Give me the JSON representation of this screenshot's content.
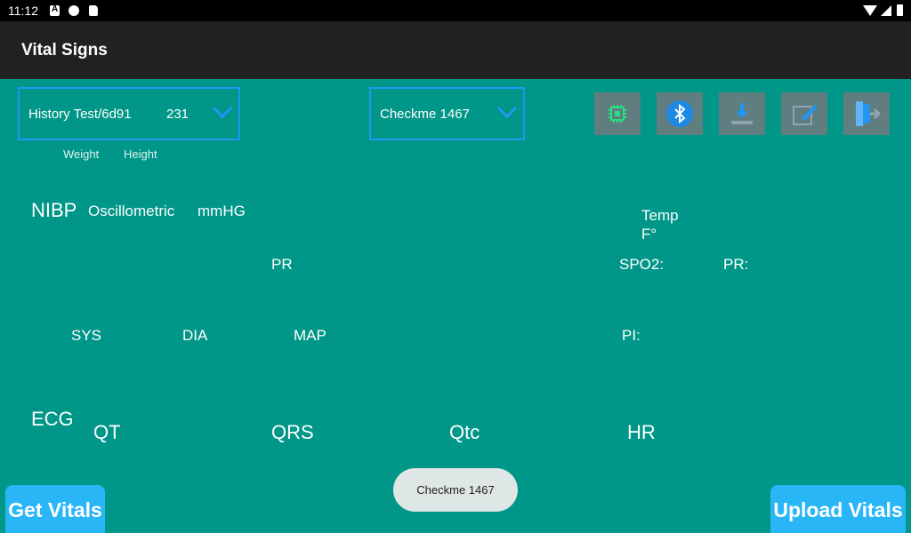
{
  "status_bar": {
    "time": "11:12"
  },
  "app_bar": {
    "title": "Vital Signs"
  },
  "patient_dropdown": {
    "name": "History Test/6d91",
    "id": "231"
  },
  "device_dropdown": {
    "value": "Checkme 1467"
  },
  "weight_label": "Weight",
  "height_label": "Height",
  "toolbar_icons": [
    "chip-icon",
    "bluetooth-icon",
    "download-icon",
    "edit-icon",
    "logout-icon"
  ],
  "nibp": {
    "title": "NIBP",
    "method": "Oscillometric",
    "unit": "mmHG",
    "pr": "PR",
    "sys": "SYS",
    "dia": "DIA",
    "map": "MAP"
  },
  "temp": {
    "label": "Temp",
    "unit": "F°"
  },
  "spo2": {
    "spo2": "SPO2:",
    "pr": "PR:",
    "pi": "PI:"
  },
  "ecg": {
    "title": "ECG",
    "qt": "QT",
    "qrs": "QRS",
    "qtc": "Qtc",
    "hr": "HR"
  },
  "toast": "Checkme 1467",
  "buttons": {
    "get_vitals": "Get Vitals",
    "upload_vitals": "Upload Vitals"
  },
  "colors": {
    "background": "#009688",
    "appbar": "#212121",
    "accent": "#2196f3",
    "button": "#29b6f6"
  }
}
